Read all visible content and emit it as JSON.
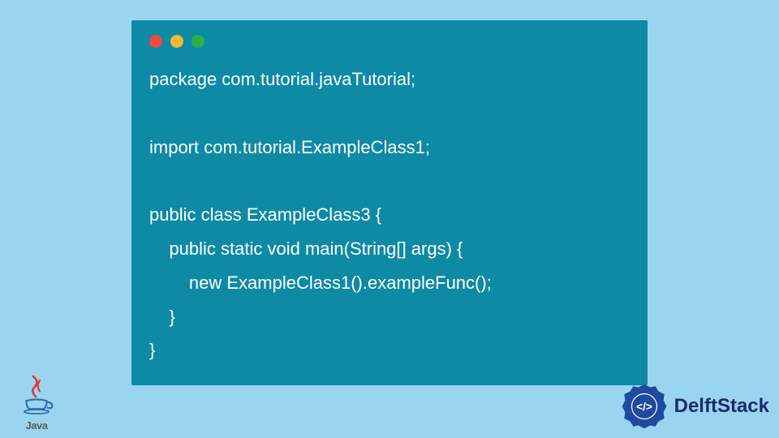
{
  "code": {
    "lines": [
      "package com.tutorial.javaTutorial;",
      "",
      "import com.tutorial.ExampleClass1;",
      "",
      "public class ExampleClass3 {",
      "    public static void main(String[] args) {",
      "        new ExampleClass1().exampleFunc();",
      "    }",
      "}"
    ]
  },
  "brand_left": {
    "label": "Java"
  },
  "brand_right": {
    "label": "DelftStack"
  },
  "colors": {
    "bg": "#9ad5ef",
    "window": "#0e8aa5",
    "dot_red": "#ee4c3e",
    "dot_yellow": "#f7b731",
    "dot_green": "#2bb04a"
  }
}
